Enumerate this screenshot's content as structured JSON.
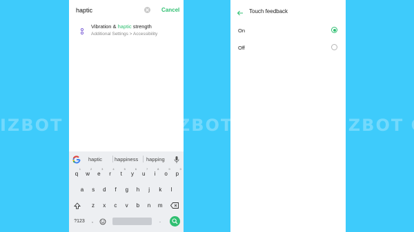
{
  "watermark": "IZBOT GIZBOT GIZBOT GIZBOT GIZBOT GIZBOT GIZBOT",
  "colors": {
    "background": "#3ecbfb",
    "accent": "#2fbf71"
  },
  "search": {
    "query": "haptic",
    "cancel_label": "Cancel",
    "result": {
      "icon": "vibration-icon",
      "title_before": "Vibration & ",
      "title_highlight": "haptic",
      "title_after": " strength",
      "path": "Additional Settings > Accessibility"
    }
  },
  "keyboard": {
    "suggestions": [
      "haptic",
      "happiness",
      "happing"
    ],
    "row1": [
      {
        "k": "q",
        "alt": "1"
      },
      {
        "k": "w",
        "alt": "2"
      },
      {
        "k": "e",
        "alt": "3"
      },
      {
        "k": "r",
        "alt": "4"
      },
      {
        "k": "t",
        "alt": "5"
      },
      {
        "k": "y",
        "alt": "6"
      },
      {
        "k": "u",
        "alt": "7"
      },
      {
        "k": "i",
        "alt": "8"
      },
      {
        "k": "o",
        "alt": "9"
      },
      {
        "k": "p",
        "alt": "0"
      }
    ],
    "row2": [
      "a",
      "s",
      "d",
      "f",
      "g",
      "h",
      "j",
      "k",
      "l"
    ],
    "row3": [
      "z",
      "x",
      "c",
      "v",
      "b",
      "n",
      "m"
    ],
    "symbols_label": "?123",
    "comma_label": ",",
    "period_label": "."
  },
  "touch_feedback": {
    "title": "Touch feedback",
    "options": [
      {
        "label": "On",
        "selected": true
      },
      {
        "label": "Off",
        "selected": false
      }
    ]
  }
}
